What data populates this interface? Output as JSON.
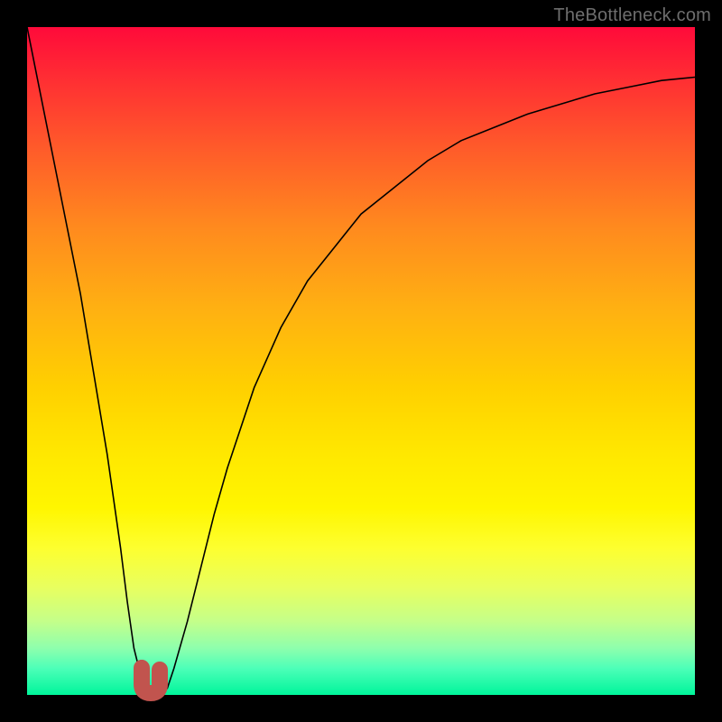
{
  "watermark": "TheBottleneck.com",
  "chart_data": {
    "type": "line",
    "title": "",
    "xlabel": "",
    "ylabel": "",
    "xlim": [
      0,
      100
    ],
    "ylim": [
      0,
      100
    ],
    "grid": false,
    "legend": null,
    "background_gradient": {
      "top_color": "#ff0a3a",
      "bottom_color": "#00f59b",
      "description": "vertical red-to-green gradient indicating bottleneck severity (top=bad, bottom=good)"
    },
    "series": [
      {
        "name": "bottleneck-curve",
        "x": [
          0,
          2,
          4,
          6,
          8,
          10,
          12,
          14,
          15,
          16,
          17,
          18,
          19,
          20,
          21,
          22,
          24,
          26,
          28,
          30,
          34,
          38,
          42,
          46,
          50,
          55,
          60,
          65,
          70,
          75,
          80,
          85,
          90,
          95,
          100
        ],
        "values": [
          100,
          90,
          80,
          70,
          60,
          48,
          36,
          22,
          14,
          7,
          3,
          1,
          0,
          0,
          1,
          4,
          11,
          19,
          27,
          34,
          46,
          55,
          62,
          67,
          72,
          76,
          80,
          83,
          85,
          87,
          88.5,
          90,
          91,
          92,
          92.5
        ]
      }
    ],
    "optimal_marker": {
      "x": 18.5,
      "y": 0,
      "color": "#c1544e",
      "shape": "J-hook"
    }
  }
}
